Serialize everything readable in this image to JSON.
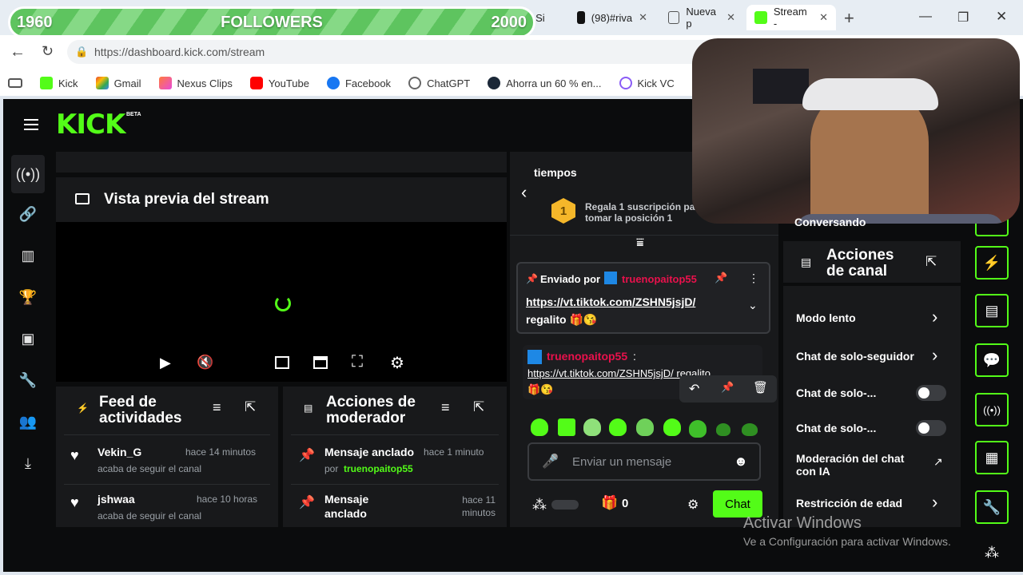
{
  "browser": {
    "tabs": [
      {
        "label": "k Si",
        "partial": true
      },
      {
        "label": "(98)#riva"
      },
      {
        "label": "Nueva p"
      },
      {
        "label": "Stream -",
        "active": true
      }
    ],
    "new_tab": "+",
    "url": "https://dashboard.kick.com/stream",
    "bookmarks": [
      "Kick",
      "Gmail",
      "Nexus Clips",
      "YouTube",
      "Facebook",
      "ChatGPT",
      "Ahorra un 60 % en...",
      "Kick VC"
    ]
  },
  "overlay": {
    "followers_start": "1960",
    "followers_label": "FOLLOWERS",
    "followers_goal": "2000",
    "webcam_status": "Conversando"
  },
  "app": {
    "logo": "KICK",
    "logo_badge": "BETA",
    "preview_title": "Vista previa del stream",
    "feed": {
      "title_line1": "Feed de",
      "title_line2": "actividades",
      "items": [
        {
          "user": "Vekin_G",
          "time": "hace 14 minutos",
          "text": "acaba de seguir el canal"
        },
        {
          "user": "jshwaa",
          "time": "hace 10 horas",
          "text": "acaba de seguir el canal"
        }
      ]
    },
    "mod": {
      "title_line1": "Acciones de",
      "title_line2": "moderador",
      "items": [
        {
          "title": "Mensaje anclado",
          "time": "hace 1 minuto",
          "by": "por",
          "user": "truenopaitop55"
        },
        {
          "title_line1": "Mensaje",
          "title_line2": "anclado",
          "time_line1": "hace 11",
          "time_line2": "minutos"
        }
      ]
    },
    "chat": {
      "top_label": "tiempos",
      "gift_rank": "1",
      "gift_text_line1": "Regala 1 suscripción pa",
      "gift_text_line2": "tomar la posición 1",
      "pinned_by": "Enviado por",
      "pinned_user": "truenopaitop55",
      "pinned_link": "https://vt.tiktok.com/ZSHN5jsjD/",
      "pinned_text": "regalito 🎁😘",
      "msg_user": "truenopaitop55",
      "msg_link": "https://vt.tiktok.com/ZSHN5jsjD/ regalito",
      "msg_emoji": "🎁😘",
      "input_placeholder": "Enviar un mensaje",
      "count": "0",
      "send_label": "Chat"
    },
    "actions": {
      "title_line1": "Acciones",
      "title_line2": "de canal",
      "items": [
        {
          "label": "Modo lento",
          "kind": "chevron"
        },
        {
          "label": "Chat de solo-seguidor",
          "kind": "chevron"
        },
        {
          "label": "Chat de solo-...",
          "kind": "toggle"
        },
        {
          "label": "Chat de solo-...",
          "kind": "toggle"
        },
        {
          "label_line1": "Moderación del chat",
          "label_line2": "con IA",
          "kind": "external"
        },
        {
          "label": "Restricción de edad",
          "kind": "chevron"
        }
      ]
    }
  },
  "watermark": {
    "line1": "Activar Windows",
    "line2": "Ve a Configuración para activar Windows."
  }
}
